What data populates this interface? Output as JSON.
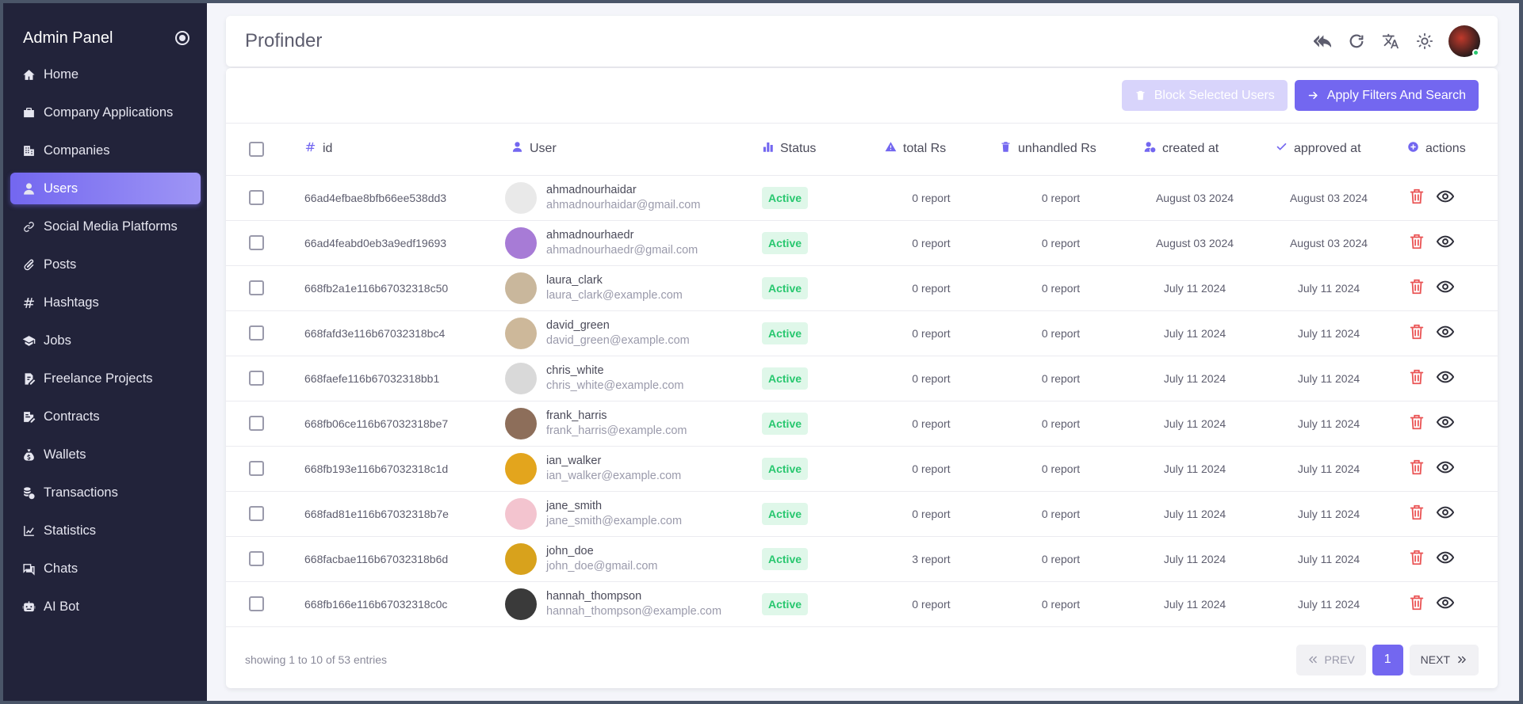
{
  "sidebar": {
    "title": "Admin Panel",
    "items": [
      {
        "label": "Home",
        "icon": "home-icon"
      },
      {
        "label": "Company Applications",
        "icon": "briefcase-icon"
      },
      {
        "label": "Companies",
        "icon": "building-icon"
      },
      {
        "label": "Users",
        "icon": "user-icon",
        "active": true
      },
      {
        "label": "Social Media Platforms",
        "icon": "link-icon"
      },
      {
        "label": "Posts",
        "icon": "paperclip-icon"
      },
      {
        "label": "Hashtags",
        "icon": "hashtag-icon"
      },
      {
        "label": "Jobs",
        "icon": "graduation-cap-icon"
      },
      {
        "label": "Freelance Projects",
        "icon": "file-edit-icon"
      },
      {
        "label": "Contracts",
        "icon": "signature-icon"
      },
      {
        "label": "Wallets",
        "icon": "money-bag-icon"
      },
      {
        "label": "Transactions",
        "icon": "coins-icon"
      },
      {
        "label": "Statistics",
        "icon": "chart-line-icon"
      },
      {
        "label": "Chats",
        "icon": "chat-icon"
      },
      {
        "label": "AI Bot",
        "icon": "robot-icon"
      }
    ]
  },
  "header": {
    "title": "Profinder"
  },
  "toolbar": {
    "block_label": "Block Selected Users",
    "apply_label": "Apply Filters And Search"
  },
  "table": {
    "columns": {
      "id": "id",
      "user": "User",
      "status": "Status",
      "total": "total Rs",
      "unhandled": "unhandled Rs",
      "created": "created at",
      "approved": "approved at",
      "actions": "actions"
    },
    "rows": [
      {
        "id": "66ad4efbae8bfb66ee538dd3",
        "name": "ahmadnourhaidar",
        "email": "ahmadnourhaidar@gmail.com",
        "status": "Active",
        "total": "0 report",
        "unhandled": "0 report",
        "created": "August 03 2024",
        "approved": "August 03 2024",
        "avatar": "#e9e9e9"
      },
      {
        "id": "66ad4feabd0eb3a9edf19693",
        "name": "ahmadnourhaedr",
        "email": "ahmadnourhaedr@gmail.com",
        "status": "Active",
        "total": "0 report",
        "unhandled": "0 report",
        "created": "August 03 2024",
        "approved": "August 03 2024",
        "avatar": "#a77bd6"
      },
      {
        "id": "668fb2a1e116b67032318c50",
        "name": "laura_clark",
        "email": "laura_clark@example.com",
        "status": "Active",
        "total": "0 report",
        "unhandled": "0 report",
        "created": "July 11 2024",
        "approved": "July 11 2024",
        "avatar": "#c9b79c"
      },
      {
        "id": "668fafd3e116b67032318bc4",
        "name": "david_green",
        "email": "david_green@example.com",
        "status": "Active",
        "total": "0 report",
        "unhandled": "0 report",
        "created": "July 11 2024",
        "approved": "July 11 2024",
        "avatar": "#cdb89a"
      },
      {
        "id": "668faefe116b67032318bb1",
        "name": "chris_white",
        "email": "chris_white@example.com",
        "status": "Active",
        "total": "0 report",
        "unhandled": "0 report",
        "created": "July 11 2024",
        "approved": "July 11 2024",
        "avatar": "#d9d9d9"
      },
      {
        "id": "668fb06ce116b67032318be7",
        "name": "frank_harris",
        "email": "frank_harris@example.com",
        "status": "Active",
        "total": "0 report",
        "unhandled": "0 report",
        "created": "July 11 2024",
        "approved": "July 11 2024",
        "avatar": "#8d6e5a"
      },
      {
        "id": "668fb193e116b67032318c1d",
        "name": "ian_walker",
        "email": "ian_walker@example.com",
        "status": "Active",
        "total": "0 report",
        "unhandled": "0 report",
        "created": "July 11 2024",
        "approved": "July 11 2024",
        "avatar": "#e3a51d"
      },
      {
        "id": "668fad81e116b67032318b7e",
        "name": "jane_smith",
        "email": "jane_smith@example.com",
        "status": "Active",
        "total": "0 report",
        "unhandled": "0 report",
        "created": "July 11 2024",
        "approved": "July 11 2024",
        "avatar": "#f3c4cf"
      },
      {
        "id": "668facbae116b67032318b6d",
        "name": "john_doe",
        "email": "john_doe@gmail.com",
        "status": "Active",
        "total": "3 report",
        "unhandled": "0 report",
        "created": "July 11 2024",
        "approved": "July 11 2024",
        "avatar": "#d8a21c"
      },
      {
        "id": "668fb166e116b67032318c0c",
        "name": "hannah_thompson",
        "email": "hannah_thompson@example.com",
        "status": "Active",
        "total": "0 report",
        "unhandled": "0 report",
        "created": "July 11 2024",
        "approved": "July 11 2024",
        "avatar": "#3a3a3a"
      }
    ]
  },
  "footer": {
    "entries_text": "showing 1 to 10 of 53 entries",
    "prev_label": "PREV",
    "page": "1",
    "next_label": "NEXT"
  },
  "colors": {
    "accent": "#7367f0",
    "sidebar_bg": "#22233a",
    "success": "#28c76f",
    "danger": "#ea5455"
  }
}
